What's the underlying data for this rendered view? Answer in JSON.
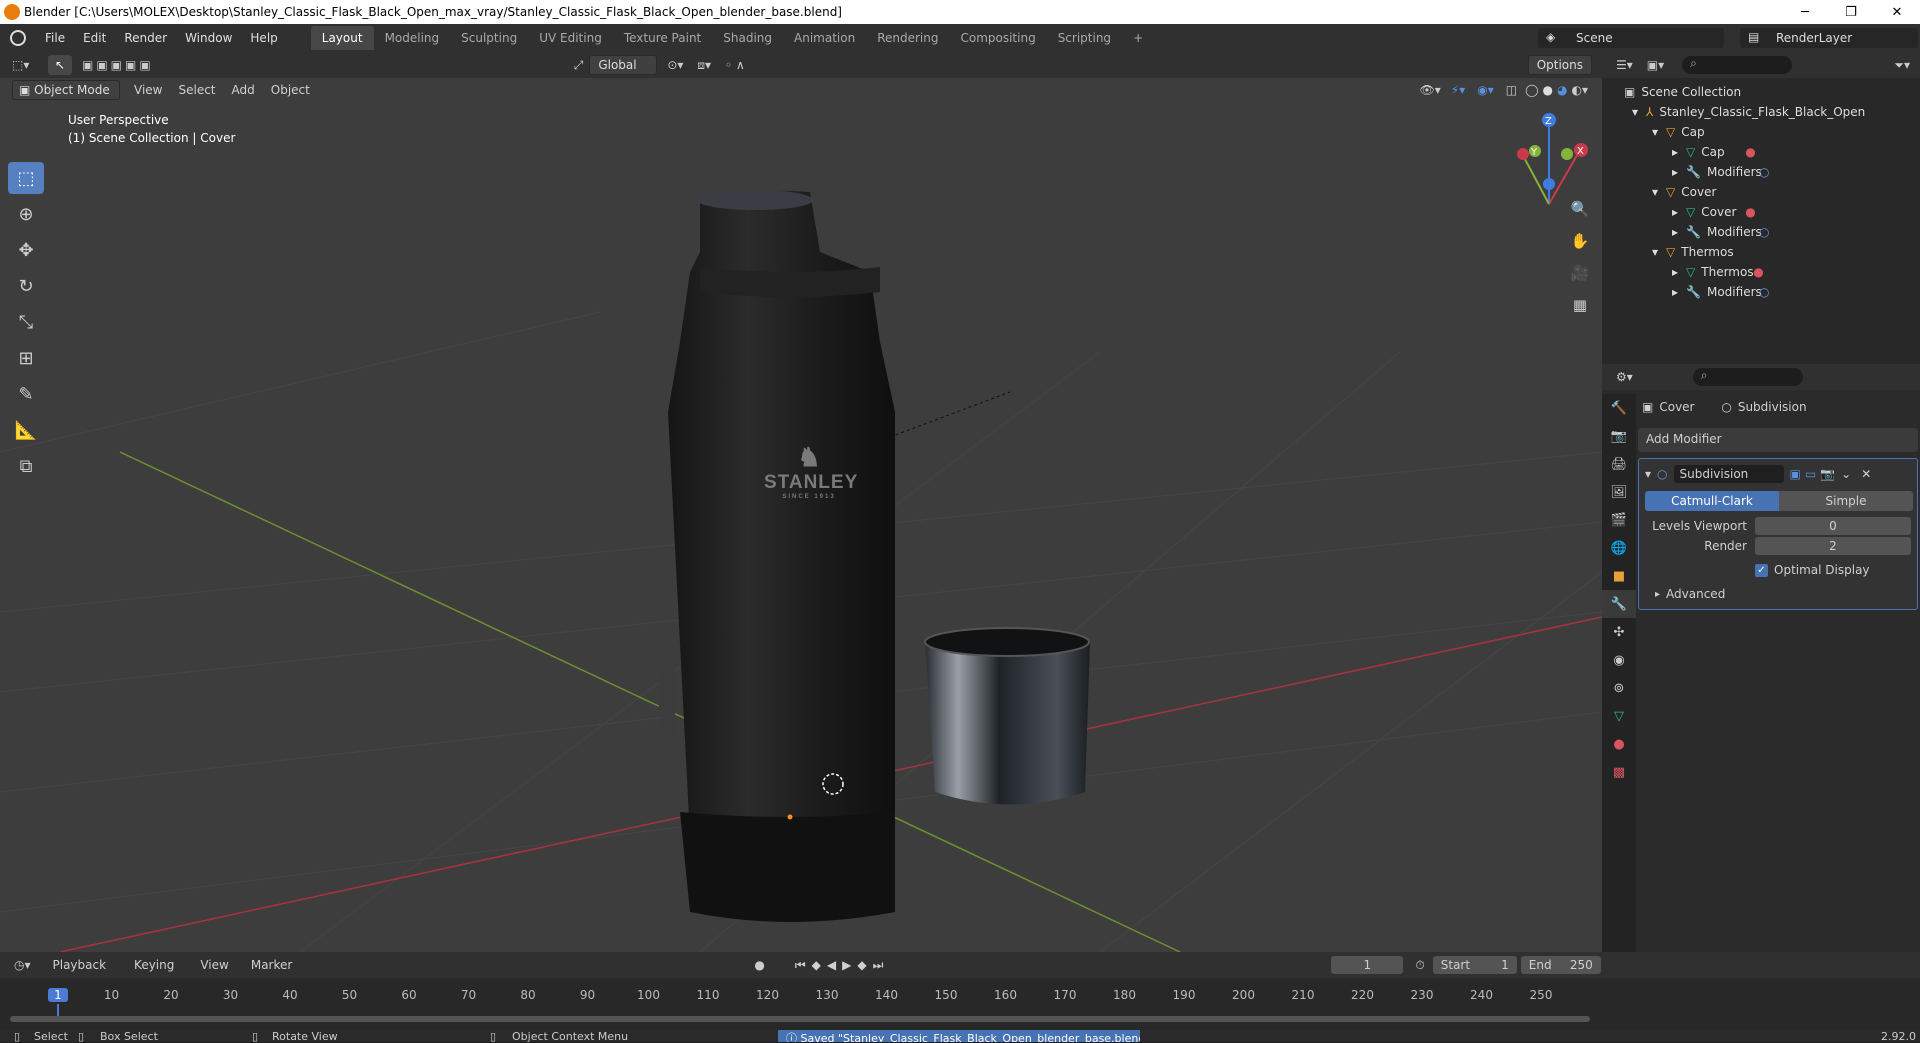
{
  "window": {
    "title": "Blender [C:\\Users\\MOLEX\\Desktop\\Stanley_Classic_Flask_Black_Open_max_vray/Stanley_Classic_Flask_Black_Open_blender_base.blend]",
    "minimize": "─",
    "maximize": "❐",
    "close": "✕"
  },
  "menu": [
    "File",
    "Edit",
    "Render",
    "Window",
    "Help"
  ],
  "workspaces": [
    "Layout",
    "Modeling",
    "Sculpting",
    "UV Editing",
    "Texture Paint",
    "Shading",
    "Animation",
    "Rendering",
    "Compositing",
    "Scripting"
  ],
  "workspace_add": "+",
  "scene": {
    "name": "Scene",
    "render_layer": "RenderLayer"
  },
  "viewport_header": {
    "transform_orientation": "Global",
    "options": "Options",
    "mode": "Object Mode",
    "menus": [
      "View",
      "Select",
      "Add",
      "Object"
    ]
  },
  "viewport_info": {
    "line1": "User Perspective",
    "line2": "(1) Scene Collection | Cover"
  },
  "gizmo": {
    "x": "X",
    "y": "Y",
    "z": "Z"
  },
  "product_logo": {
    "brand": "STANLEY",
    "since": "SINCE 1913"
  },
  "outliner": {
    "root": "Scene Collection",
    "collection": "Stanley_Classic_Flask_Black_Open",
    "objects": [
      {
        "name": "Cap",
        "mesh": "Cap",
        "modifiers": "Modifiers"
      },
      {
        "name": "Cover",
        "mesh": "Cover",
        "modifiers": "Modifiers"
      },
      {
        "name": "Thermos",
        "mesh": "Thermos",
        "modifiers": "Modifiers"
      }
    ]
  },
  "properties": {
    "object": "Cover",
    "modifier_type": "Subdivision",
    "add_modifier": "Add Modifier",
    "modifier_name": "Subdivision",
    "algo_active": "Catmull-Clark",
    "algo_other": "Simple",
    "levels_viewport_label": "Levels Viewport",
    "levels_viewport": "0",
    "render_label": "Render",
    "render": "2",
    "optimal_display": "Optimal Display",
    "advanced": "Advanced"
  },
  "timeline": {
    "menus": [
      "Playback",
      "Keying",
      "View",
      "Marker"
    ],
    "current_frame": "1",
    "start_label": "Start",
    "start": "1",
    "end_label": "End",
    "end": "250",
    "ticks": [
      "1",
      "10",
      "20",
      "30",
      "40",
      "50",
      "60",
      "70",
      "80",
      "90",
      "100",
      "110",
      "120",
      "130",
      "140",
      "150",
      "160",
      "170",
      "180",
      "190",
      "200",
      "210",
      "220",
      "230",
      "240",
      "250"
    ]
  },
  "statusbar": {
    "select": "Select",
    "box_select": "Box Select",
    "rotate_view": "Rotate View",
    "context_menu": "Object Context Menu",
    "message": "Saved \"Stanley_Classic_Flask_Black_Open_blender_base.blend\"",
    "version": "2.92.0"
  },
  "colors": {
    "accent": "#4772b3",
    "x_axis": "#c93a4a",
    "y_axis": "#86b33a",
    "z_axis": "#3f7be0",
    "tl_current": "#4b7bd2"
  }
}
